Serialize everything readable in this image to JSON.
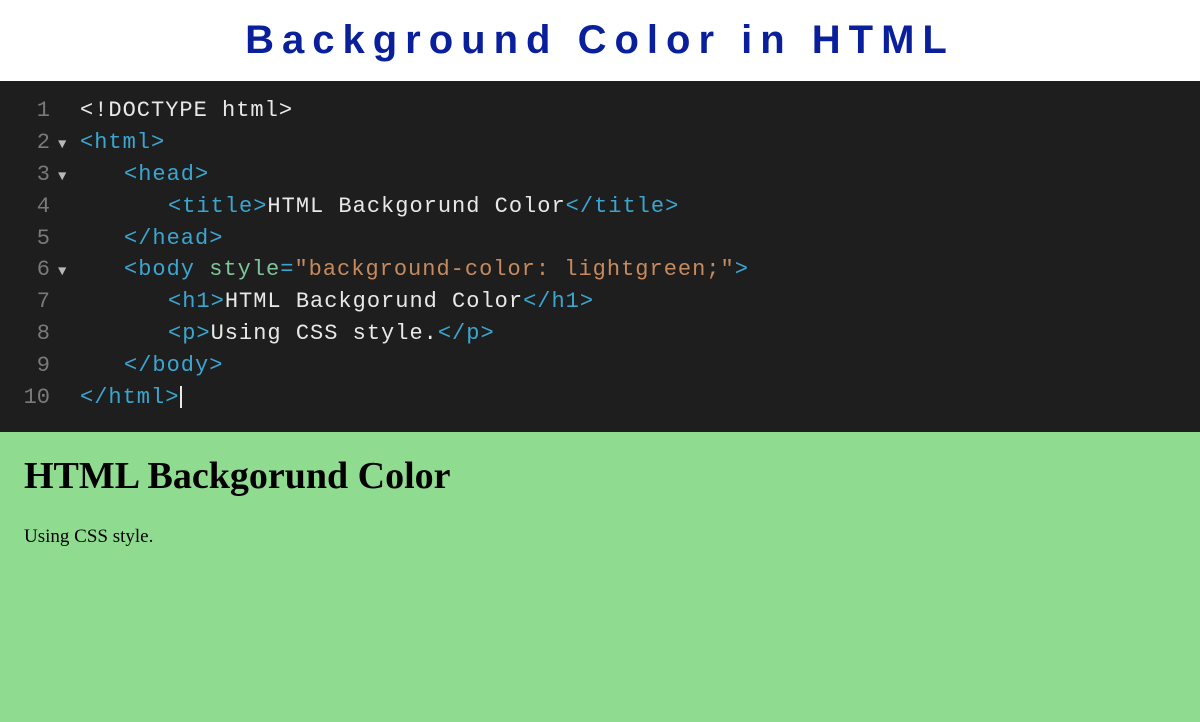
{
  "header": {
    "title": "Background Color in HTML"
  },
  "code": {
    "lines": [
      {
        "num": "1",
        "fold": "",
        "indent": 0,
        "tokens": [
          {
            "cls": "doctype",
            "t": "<!DOCTYPE html>"
          }
        ]
      },
      {
        "num": "2",
        "fold": "▼",
        "indent": 0,
        "tokens": [
          {
            "cls": "tag",
            "t": "<html>"
          }
        ]
      },
      {
        "num": "3",
        "fold": "▼",
        "indent": 1,
        "tokens": [
          {
            "cls": "tag",
            "t": "<head>"
          }
        ]
      },
      {
        "num": "4",
        "fold": "",
        "indent": 2,
        "tokens": [
          {
            "cls": "tag",
            "t": "<title>"
          },
          {
            "cls": "text-content",
            "t": "HTML Backgorund Color"
          },
          {
            "cls": "tag",
            "t": "</title>"
          }
        ]
      },
      {
        "num": "5",
        "fold": "",
        "indent": 1,
        "tokens": [
          {
            "cls": "tag",
            "t": "</head>"
          }
        ]
      },
      {
        "num": "6",
        "fold": "▼",
        "indent": 1,
        "tokens": [
          {
            "cls": "tag",
            "t": "<body "
          },
          {
            "cls": "attr-name",
            "t": "style"
          },
          {
            "cls": "tag",
            "t": "="
          },
          {
            "cls": "attr-value",
            "t": "\"background-color: lightgreen;\""
          },
          {
            "cls": "tag",
            "t": ">"
          }
        ]
      },
      {
        "num": "7",
        "fold": "",
        "indent": 2,
        "tokens": [
          {
            "cls": "tag",
            "t": "<h1>"
          },
          {
            "cls": "text-content",
            "t": "HTML Backgorund Color"
          },
          {
            "cls": "tag",
            "t": "</h1>"
          }
        ]
      },
      {
        "num": "8",
        "fold": "",
        "indent": 2,
        "tokens": [
          {
            "cls": "tag",
            "t": "<p>"
          },
          {
            "cls": "text-content",
            "t": "Using CSS style."
          },
          {
            "cls": "tag",
            "t": "</p>"
          }
        ]
      },
      {
        "num": "9",
        "fold": "",
        "indent": 1,
        "tokens": [
          {
            "cls": "tag",
            "t": "</body>"
          }
        ]
      },
      {
        "num": "10",
        "fold": "",
        "indent": 0,
        "tokens": [
          {
            "cls": "tag",
            "t": "</html>"
          }
        ],
        "cursor": true
      }
    ]
  },
  "preview": {
    "heading": "HTML Backgorund Color",
    "paragraph": "Using CSS style."
  }
}
